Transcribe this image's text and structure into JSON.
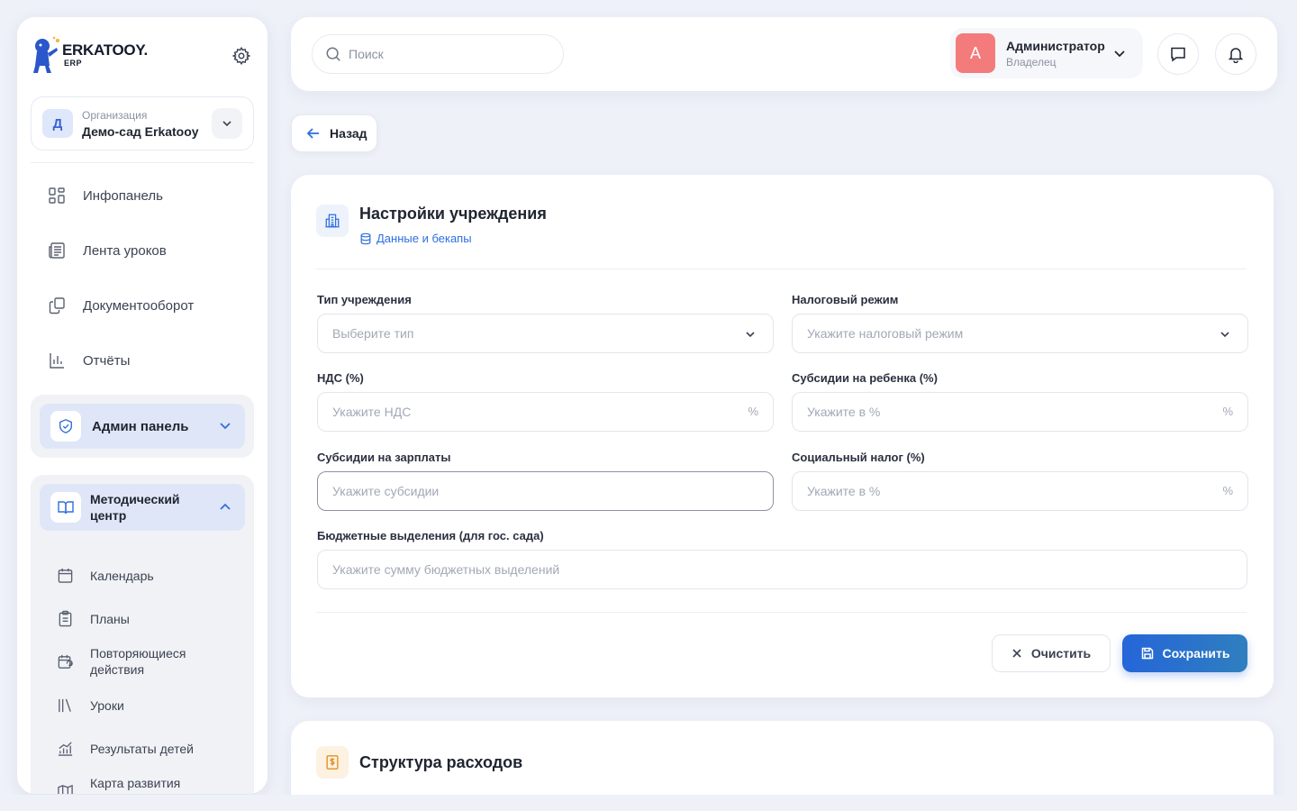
{
  "brand": {
    "name": "ERKATOOY.",
    "sub": "ERP"
  },
  "org": {
    "avatar": "Д",
    "label": "Организация",
    "name": "Демо-сад Erkatooy"
  },
  "nav": {
    "dashboard": "Инфопанель",
    "lessons_feed": "Лента уроков",
    "documents": "Документооборот",
    "reports": "Отчёты"
  },
  "admin": {
    "label": "Админ панель"
  },
  "method": {
    "label": "Методический центр",
    "items": {
      "calendar": "Календарь",
      "plans": "Планы",
      "recurring": "Повторяющиеся действия",
      "lessons": "Уроки",
      "results": "Результаты детей",
      "map": "Карта развития ребенка"
    }
  },
  "topbar": {
    "search_placeholder": "Поиск",
    "user": {
      "avatar": "А",
      "name": "Администратор",
      "role": "Владелец"
    }
  },
  "back": "Назад",
  "settings": {
    "title": "Настройки учреждения",
    "link": "Данные и бекапы",
    "fields": {
      "type": {
        "label": "Тип учреждения",
        "placeholder": "Выберите тип"
      },
      "tax": {
        "label": "Налоговый режим",
        "placeholder": "Укажите налоговый режим"
      },
      "vat": {
        "label": "НДС (%)",
        "placeholder": "Укажите НДС",
        "suffix": "%"
      },
      "child_subsidy": {
        "label": "Субсидии на ребенка (%)",
        "placeholder": "Укажите в %",
        "suffix": "%"
      },
      "salary_subsidy": {
        "label": "Субсидии на зарплаты",
        "placeholder": "Укажите субсидии"
      },
      "social_tax": {
        "label": "Социальный налог (%)",
        "placeholder": "Укажите в %",
        "suffix": "%"
      },
      "budget": {
        "label": "Бюджетные выделения (для гос. сада)",
        "placeholder": "Укажите сумму бюджетных выделений"
      }
    },
    "clear": "Очистить",
    "save": "Сохранить"
  },
  "expenses": {
    "title": "Структура расходов"
  },
  "colors": {
    "accent": "#2565d9",
    "avatar_user": "#f37b7b",
    "active_nav": "#dfe6f7"
  }
}
